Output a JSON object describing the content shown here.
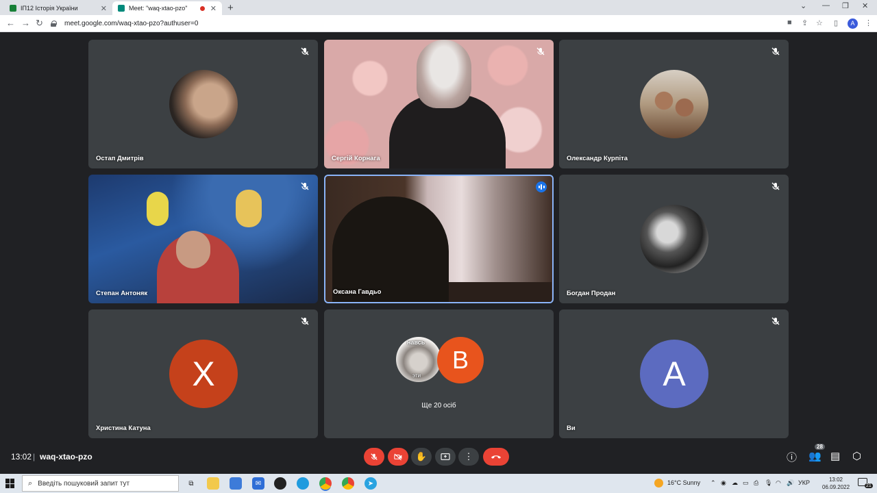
{
  "browser": {
    "tabs": [
      {
        "title": "ІП12 Історія України",
        "active": false,
        "favicon_color": "#188038"
      },
      {
        "title": "Meet: \"waq-xtao-pzo\"",
        "active": true,
        "favicon_color": "#00897b",
        "recording": true
      }
    ],
    "url": "meet.google.com/waq-xtao-pzo?authuser=0",
    "profile_initial": "A"
  },
  "meeting": {
    "tiles": [
      {
        "name": "Остап Дмитрів",
        "muted": true,
        "type": "avatar-photo"
      },
      {
        "name": "Сергій Корнага",
        "muted": true,
        "type": "video"
      },
      {
        "name": "Олександр Курпіта",
        "muted": true,
        "type": "avatar-photo"
      },
      {
        "name": "Степан Антоняк",
        "muted": true,
        "type": "video"
      },
      {
        "name": "Оксана Гавдьо",
        "muted": false,
        "speaking": true,
        "type": "video"
      },
      {
        "name": "Богдан Продан",
        "muted": true,
        "type": "avatar-photo"
      },
      {
        "name": "Христина Катуна",
        "muted": true,
        "type": "letter",
        "letter": "Х",
        "color": "#c5411b"
      },
      {
        "name": "Ще 20 осіб",
        "type": "others",
        "letter": "В",
        "color": "#e8541d",
        "sticker_text_top": "навсь",
        "sticker_text_bottom": "эти"
      },
      {
        "name": "Ви",
        "muted": true,
        "type": "letter",
        "letter": "A",
        "color": "#5c6bc0"
      }
    ],
    "time": "13:02",
    "meeting_code": "waq-xtao-pzo",
    "participants_count": "28",
    "controls": [
      "mic-off",
      "camera-off",
      "raise-hand",
      "present",
      "more",
      "leave-call"
    ]
  },
  "taskbar": {
    "search_placeholder": "Введіть пошуковий запит тут",
    "weather": "16°C  Sunny",
    "language": "УКР",
    "clock_time": "13:02",
    "clock_date": "06.09.2022",
    "notifications": "21"
  }
}
